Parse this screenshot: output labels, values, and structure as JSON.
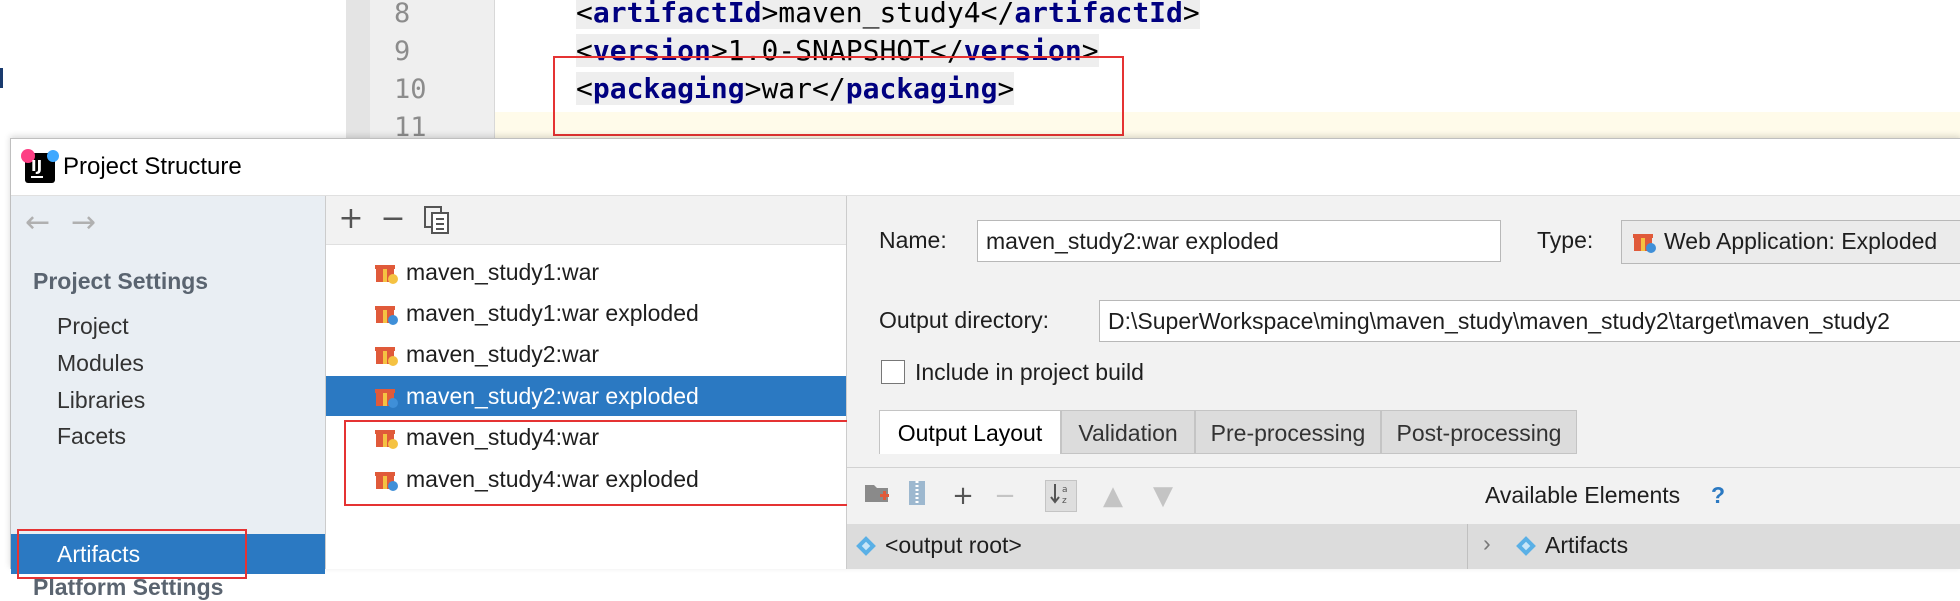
{
  "editor": {
    "lines": [
      {
        "num": "8",
        "open": "artifactId",
        "text": "maven_study4",
        "close": "artifactId"
      },
      {
        "num": "9",
        "open": "version",
        "text": "1.0-SNAPSHOT",
        "close": "version"
      },
      {
        "num": "10",
        "open": "packaging",
        "text": "war",
        "close": "packaging"
      },
      {
        "num": "11"
      }
    ]
  },
  "dialog": {
    "title": "Project Structure",
    "nav": {
      "back_icon": "arrow-left-icon",
      "forward_icon": "arrow-right-icon",
      "section_label": "Project Settings",
      "items": [
        "Project",
        "Modules",
        "Libraries",
        "Facets",
        "Artifacts"
      ],
      "selected": "Artifacts",
      "section2_label": "Platform Settings"
    },
    "list": {
      "toolbar": {
        "add": "+",
        "remove": "−",
        "copy_icon": "copy-icon"
      },
      "artifacts": [
        "maven_study1:war",
        "maven_study1:war exploded",
        "maven_study2:war",
        "maven_study2:war exploded",
        "maven_study4:war",
        "maven_study4:war exploded"
      ],
      "selected": "maven_study2:war exploded"
    },
    "details": {
      "name_label": "Name:",
      "name_value": "maven_study2:war exploded",
      "type_label": "Type:",
      "type_value": "Web Application: Exploded",
      "output_label": "Output directory:",
      "output_value": "D:\\SuperWorkspace\\ming\\maven_study\\maven_study2\\target\\maven_study2",
      "include_label": "Include in project build",
      "include_checked": false,
      "tabs": [
        "Output Layout",
        "Validation",
        "Pre-processing",
        "Post-processing"
      ],
      "active_tab": "Output Layout",
      "available_label": "Available Elements",
      "help": "?",
      "tree_root": "<output root>",
      "tree_artifacts": "Artifacts"
    }
  },
  "colors": {
    "selection": "#2b79c2",
    "annotation": "#e53333",
    "xml_tag": "#000080"
  }
}
